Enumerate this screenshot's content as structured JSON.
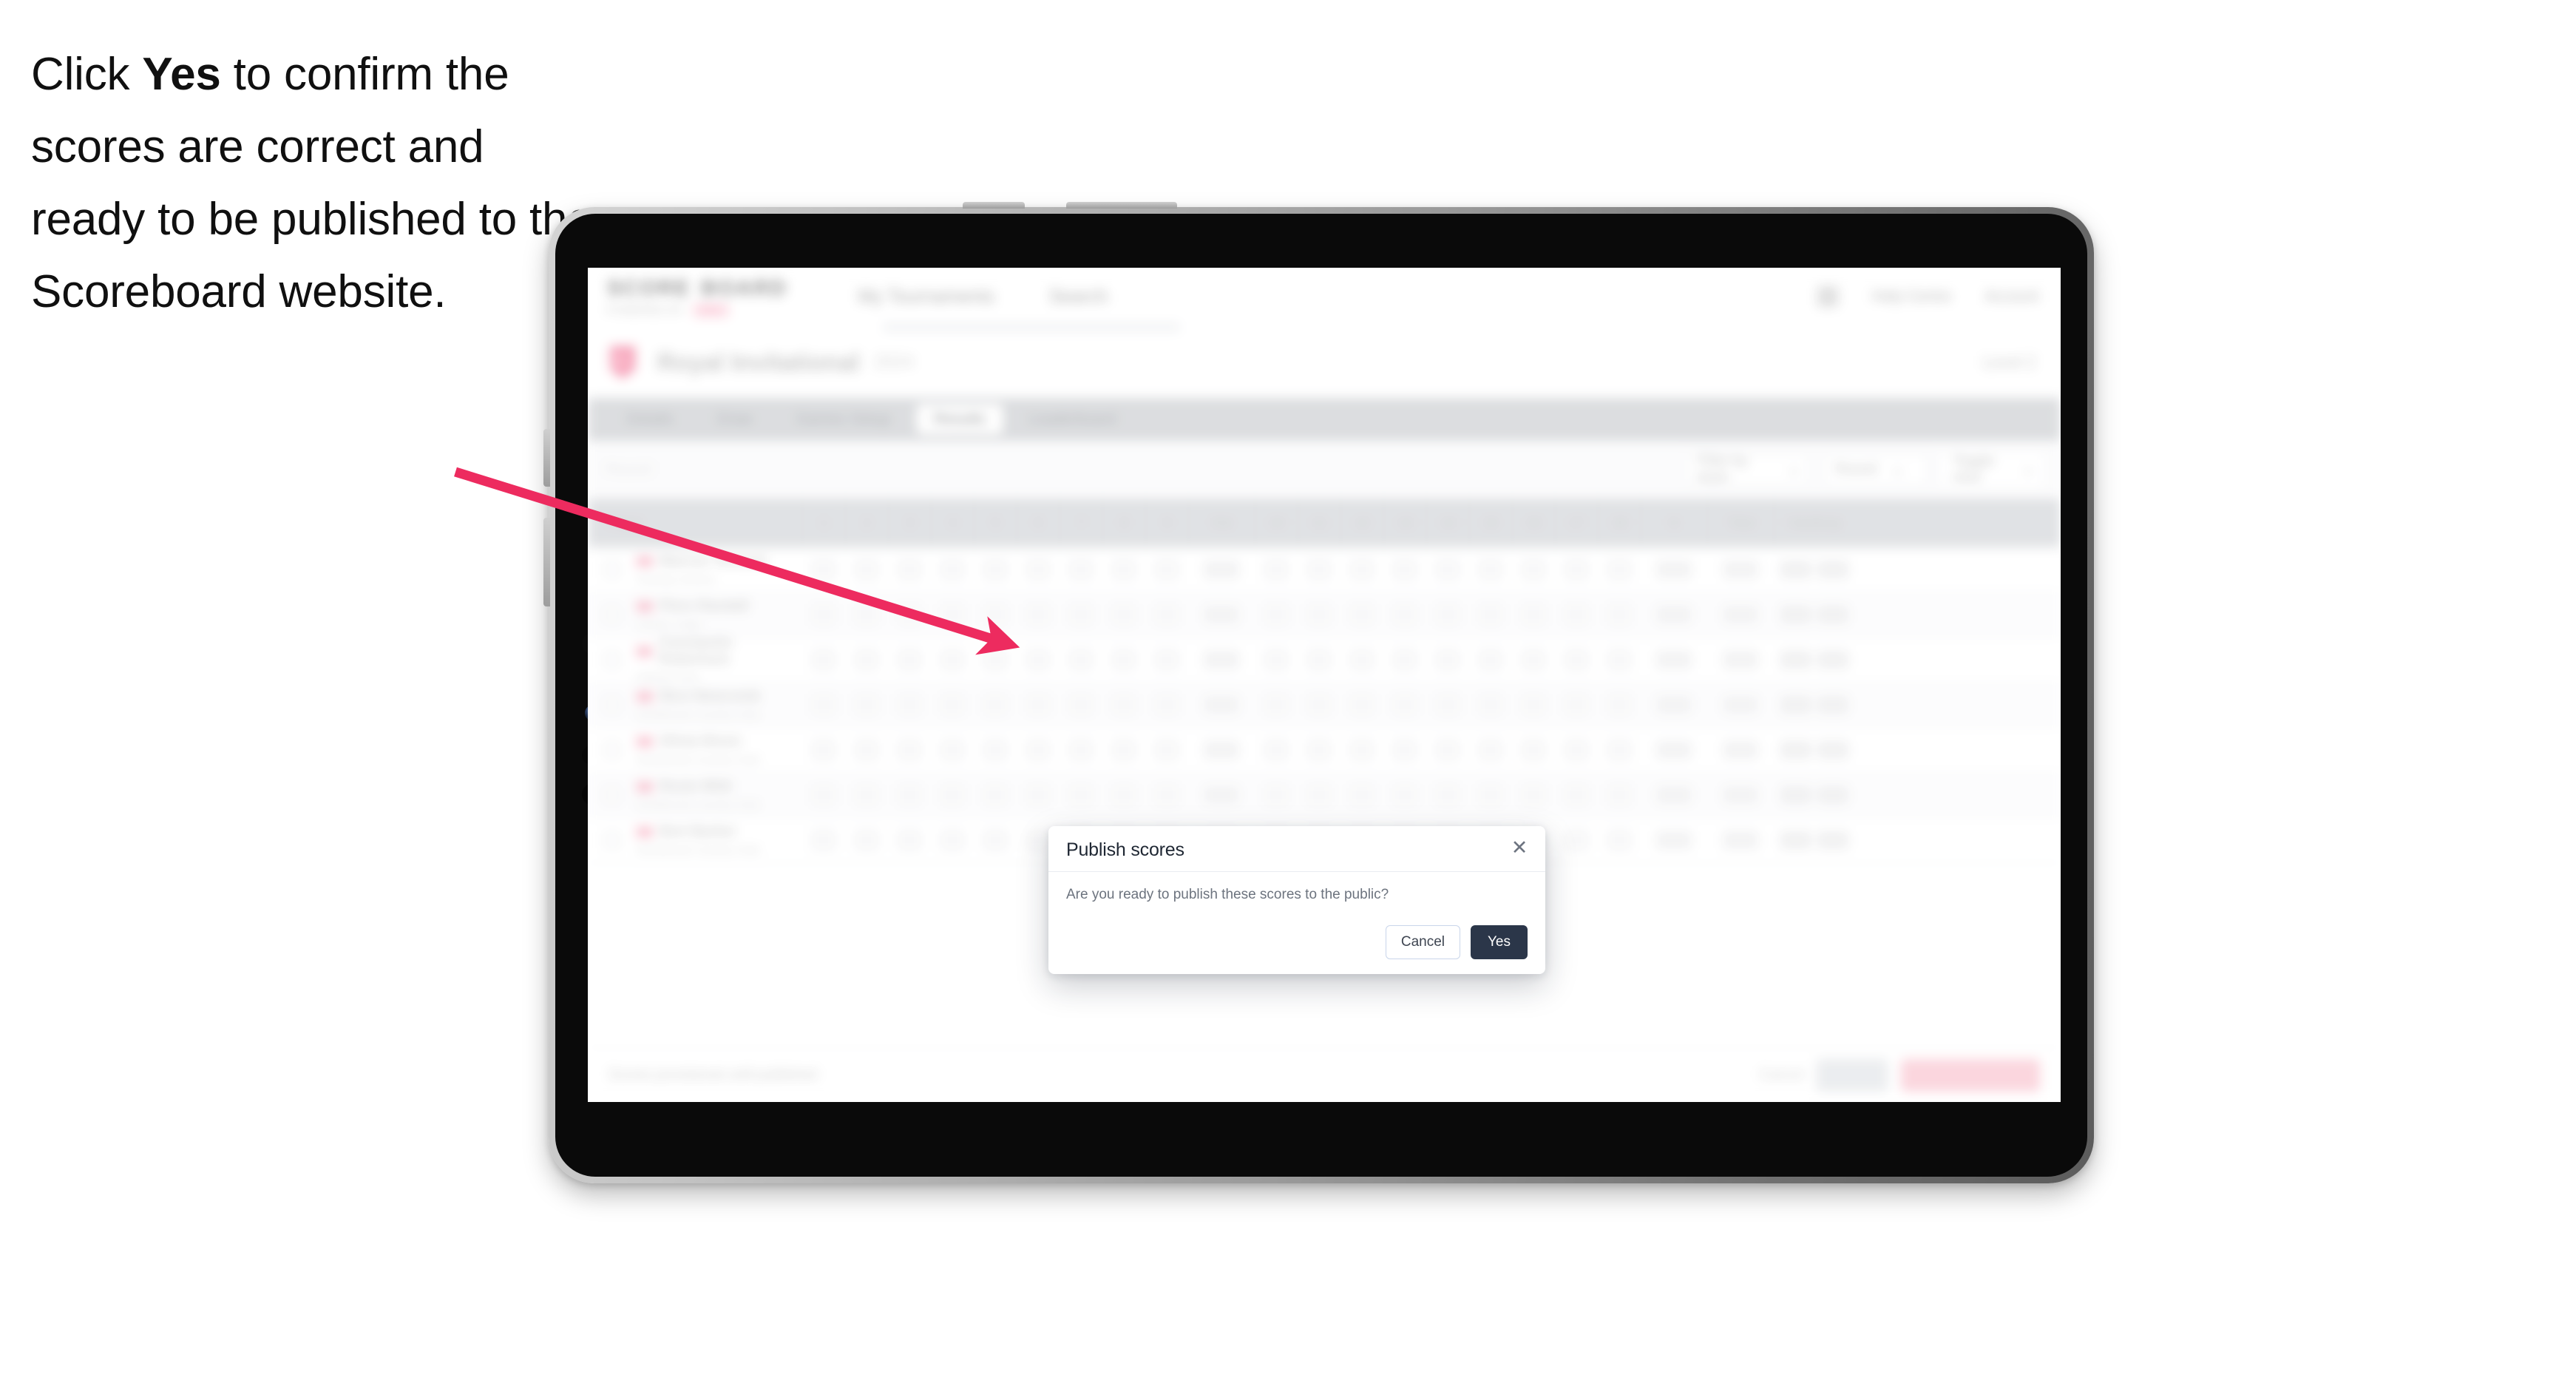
{
  "instruction": {
    "before": "Click ",
    "emphasis": "Yes",
    "after": " to confirm the scores are correct and ready to be published to the Scoreboard website."
  },
  "colors": {
    "arrow": "#ED2B5F",
    "modal_primary": "#2B3649",
    "modal_cancel_border": "#C9D5EA",
    "device_bezel": "#0A0A0A",
    "tabbar_bg": "#D3D5D8",
    "danger_button": "#FBCCD6"
  },
  "app": {
    "header": {
      "brand_words": [
        "SCORE",
        "BOARD"
      ],
      "brand_sub": "POWERED BY",
      "brand_chip": "RED",
      "nav": [
        "My Tournaments",
        "Search"
      ],
      "right_icon": "bell-icon",
      "right_items": [
        "Help Centre",
        "Account"
      ]
    },
    "title": {
      "logo": "shield-logo",
      "main": "Royal Invitational",
      "sub": "2024",
      "right": "Level 2"
    },
    "tabs": [
      {
        "label": "Details",
        "active": false
      },
      {
        "label": "Draw",
        "active": false
      },
      {
        "label": "Games Setup",
        "active": false
      },
      {
        "label": "Results",
        "active": true
      },
      {
        "label": "Leaderboard",
        "active": false
      }
    ],
    "filters": {
      "left_label": "Round",
      "controls": [
        "Filter by team",
        "Round",
        "Toggle view"
      ]
    },
    "table": {
      "columns": [
        {
          "label": "Player",
          "type": "player"
        },
        {
          "label": "1",
          "type": "num"
        },
        {
          "label": "2",
          "type": "num"
        },
        {
          "label": "3",
          "type": "num"
        },
        {
          "label": "4",
          "type": "num"
        },
        {
          "label": "5",
          "type": "num"
        },
        {
          "label": "6",
          "type": "num"
        },
        {
          "label": "7",
          "type": "num"
        },
        {
          "label": "8",
          "type": "num"
        },
        {
          "label": "9",
          "type": "num"
        },
        {
          "label": "Out",
          "type": "mid"
        },
        {
          "label": "10",
          "type": "num"
        },
        {
          "label": "11",
          "type": "num"
        },
        {
          "label": "12",
          "type": "num"
        },
        {
          "label": "13",
          "type": "num"
        },
        {
          "label": "14",
          "type": "num"
        },
        {
          "label": "15",
          "type": "num"
        },
        {
          "label": "16",
          "type": "num"
        },
        {
          "label": "17",
          "type": "num"
        },
        {
          "label": "18",
          "type": "num"
        },
        {
          "label": "In",
          "type": "mid"
        },
        {
          "label": "Total",
          "type": "mid"
        },
        {
          "label": "Handicap",
          "type": "wide"
        }
      ],
      "rows": [
        {
          "name": "Marcus Tennant",
          "club": "Fairway Greens"
        },
        {
          "name": "Piers Randall",
          "club": "Sandy Lodge"
        },
        {
          "name": "Constantin Robertson",
          "club": "Hillside Park"
        },
        {
          "name": "Nico Newcomb",
          "club": "Northbrook Country Club"
        },
        {
          "name": "Olivia Nixon",
          "club": "Northbrook Country Club"
        },
        {
          "name": "Rosie Wild",
          "club": "Northbrook Country Club"
        },
        {
          "name": "Bert Barker",
          "club": "Northbrook Country Club"
        }
      ]
    },
    "footer": {
      "note": "Scores provisional until published",
      "link": "Cancel",
      "save_button": "Save",
      "publish_button": "Publish all and finalise"
    }
  },
  "modal": {
    "title": "Publish scores",
    "close_icon": "close-icon",
    "message": "Are you ready to publish these scores to the public?",
    "cancel_label": "Cancel",
    "confirm_label": "Yes"
  }
}
